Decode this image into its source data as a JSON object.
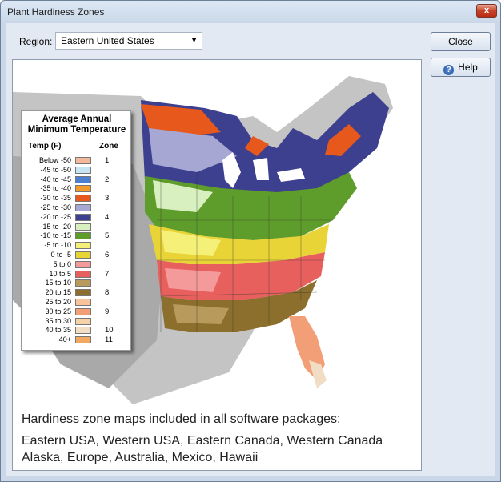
{
  "window": {
    "title": "Plant Hardiness Zones",
    "close_glyph": "x"
  },
  "region": {
    "label": "Region:",
    "selected": "Eastern United States"
  },
  "buttons": {
    "close": "Close",
    "help": "Help"
  },
  "legend": {
    "title_line1": "Average Annual",
    "title_line2": "Minimum Temperature",
    "temp_header": "Temp (F)",
    "zone_header": "Zone",
    "rows": [
      {
        "range": "Below -50",
        "color": "#f4b89a",
        "zone": "1"
      },
      {
        "range": "-45 to -50",
        "color": "#c7e4f3",
        "zone": ""
      },
      {
        "range": "-40 to -45",
        "color": "#4d7fd1",
        "zone": "2"
      },
      {
        "range": "-35 to -40",
        "color": "#f39a2a",
        "zone": ""
      },
      {
        "range": "-30 to -35",
        "color": "#e6581b",
        "zone": "3"
      },
      {
        "range": "-25 to -30",
        "color": "#a6a7d3",
        "zone": ""
      },
      {
        "range": "-20 to -25",
        "color": "#3d3f8f",
        "zone": "4"
      },
      {
        "range": "-15 to -20",
        "color": "#d8f0c0",
        "zone": ""
      },
      {
        "range": "-10 to -15",
        "color": "#5e9d2c",
        "zone": "5"
      },
      {
        "range": "-5 to -10",
        "color": "#f4f078",
        "zone": ""
      },
      {
        "range": "0 to -5",
        "color": "#e8d436",
        "zone": "6"
      },
      {
        "range": "5 to 0",
        "color": "#f59a9a",
        "zone": ""
      },
      {
        "range": "10 to 5",
        "color": "#e8605e",
        "zone": "7"
      },
      {
        "range": "15 to 10",
        "color": "#b79a5c",
        "zone": ""
      },
      {
        "range": "20 to 15",
        "color": "#8c6f2c",
        "zone": "8"
      },
      {
        "range": "25 to 20",
        "color": "#f7c39b",
        "zone": ""
      },
      {
        "range": "30 to 25",
        "color": "#f29f78",
        "zone": "9"
      },
      {
        "range": "35 to 30",
        "color": "#f6d2a8",
        "zone": ""
      },
      {
        "range": "40 to 35",
        "color": "#f1ddc3",
        "zone": "10"
      },
      {
        "range": "40+",
        "color": "#f2a860",
        "zone": "11"
      }
    ]
  },
  "caption": {
    "heading": "Hardiness zone maps included in all software packages:",
    "line1": "Eastern USA, Western USA, Eastern Canada, Western Canada",
    "line2": "Alaska, Europe, Australia, Mexico, Hawaii"
  }
}
